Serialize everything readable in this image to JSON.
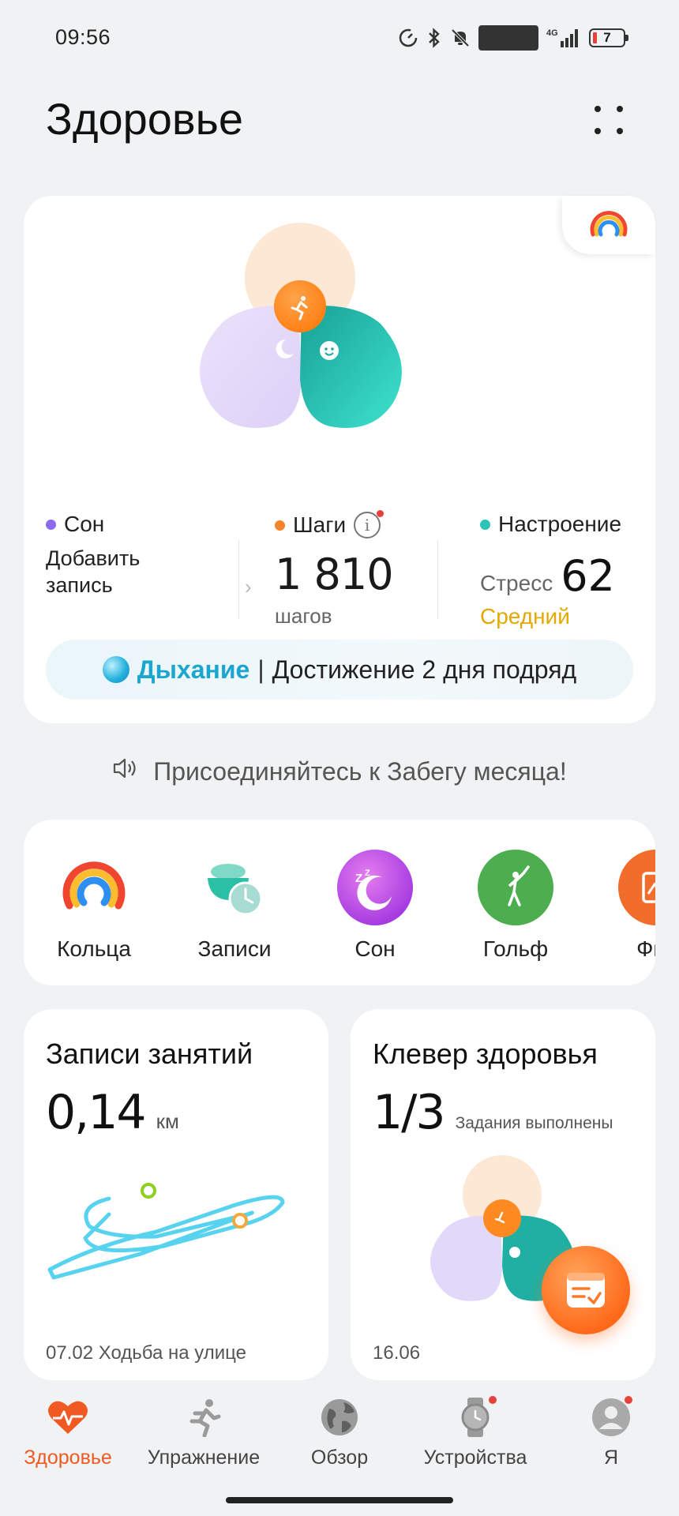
{
  "status_bar": {
    "time": "09:56",
    "icons": [
      "data-saver-icon",
      "bluetooth-icon",
      "mute-icon",
      "volte-icon",
      "signal-4g-icon",
      "battery-icon"
    ],
    "volte": "VoLTE",
    "network": "4G",
    "battery": "7",
    "battery_color": "#e8403a"
  },
  "header": {
    "title": "Здоровье",
    "menu_icon": "four-dots-icon"
  },
  "summary_card": {
    "rings_icon": "activity-rings-icon",
    "sleep": {
      "label": "Сон",
      "action": "Добавить запись",
      "color": "#8b6cf0"
    },
    "steps": {
      "label": "Шаги",
      "value": "1 810",
      "unit": "шагов",
      "color": "#f5842a"
    },
    "mood": {
      "label": "Настроение",
      "stress_label": "Стресс",
      "stress_value": "62",
      "level": "Средний",
      "level_color": "#e3a900",
      "color": "#2bc4b6"
    },
    "breathing": {
      "title": "Дыхание",
      "separator": "|",
      "text": "Достижение 2 дня подряд",
      "accent_color": "#1aa6cf"
    }
  },
  "announcement": {
    "text": "Присоединяйтесь к Забегу месяца!",
    "icon": "speaker-icon"
  },
  "shortcuts": [
    {
      "label": "Кольца",
      "icon": "activity-rings-icon"
    },
    {
      "label": "Записи",
      "icon": "records-bowl-clock-icon"
    },
    {
      "label": "Сон",
      "icon": "sleep-moon-icon"
    },
    {
      "label": "Гольф",
      "icon": "golf-icon"
    },
    {
      "label": "Фит",
      "icon": "fitness-icon"
    }
  ],
  "activity_records": {
    "title": "Записи занятий",
    "value": "0,14",
    "unit": "км",
    "date": "07.02",
    "activity": "Ходьба на улице"
  },
  "health_clover": {
    "title": "Клевер здоровья",
    "value": "1/3",
    "caption": "Задания выполнены",
    "date": "16.06"
  },
  "bottom_nav": [
    {
      "label": "Здоровье",
      "icon": "heart-pulse-icon",
      "active": true
    },
    {
      "label": "Упражнение",
      "icon": "running-person-icon",
      "active": false
    },
    {
      "label": "Обзор",
      "icon": "globe-icon",
      "active": false
    },
    {
      "label": "Устройства",
      "icon": "watch-icon",
      "active": false,
      "badge": true
    },
    {
      "label": "Я",
      "icon": "avatar-icon",
      "active": false,
      "badge": true
    }
  ],
  "colors": {
    "accent": "#f05a22",
    "background": "#f1f2f4",
    "sleep_petal": "#e3d9fa",
    "steps_petal": "#fde9d6",
    "mood_petal": "#20b5a8"
  }
}
